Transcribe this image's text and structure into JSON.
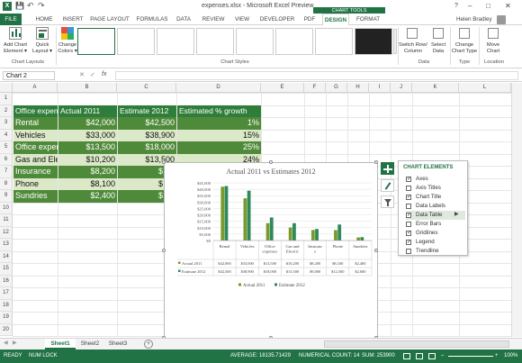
{
  "window": {
    "title": "expenses.xlsx - Microsoft Excel Preview",
    "help_btn": "?",
    "minimize": "–",
    "maximize": "□",
    "close": "✕",
    "user": "Helen Bradley",
    "qat_save": "💾",
    "qat_undo": "↶",
    "qat_redo": "↷"
  },
  "ribbon": {
    "context_label": "CHART TOOLS",
    "tabs": [
      "FILE",
      "HOME",
      "INSERT",
      "PAGE LAYOUT",
      "FORMULAS",
      "DATA",
      "REVIEW",
      "VIEW",
      "DEVELOPER",
      "PDF",
      "DESIGN",
      "FORMAT"
    ],
    "add_chart_element": "Add Chart Element ▾",
    "quick_layout": "Quick Layout ▾",
    "change_colors": "Change Colors ▾",
    "chart_layouts_label": "Chart Layouts",
    "chart_styles_label": "Chart Styles",
    "switch_row_col": "Switch Row/ Column",
    "select_data": "Select Data",
    "data_label": "Data",
    "change_chart_type": "Change Chart Type",
    "type_label": "Type",
    "move_chart": "Move Chart",
    "location_label": "Location"
  },
  "formula_bar": {
    "name_box": "Chart 2",
    "cancel": "✕",
    "enter": "✓",
    "fx": "fx",
    "content": ""
  },
  "grid": {
    "columns": [
      "A",
      "B",
      "C",
      "D",
      "E",
      "F",
      "G",
      "H",
      "I",
      "J",
      "K",
      "L"
    ],
    "rows": [
      "1",
      "2",
      "3",
      "4",
      "5",
      "6",
      "7",
      "8",
      "9",
      "10",
      "11",
      "12",
      "13",
      "14",
      "15",
      "16",
      "17",
      "18",
      "19",
      "20"
    ],
    "header_row": [
      "Office expenses",
      "Actual 2011",
      "Estimate 2012",
      "Estimated % growth"
    ],
    "data_rows": [
      {
        "label": "Rental",
        "actual": "$42,000",
        "estimate": "$42,500",
        "growth": "1%"
      },
      {
        "label": "Vehicles",
        "actual": "$33,000",
        "estimate": "$38,900",
        "growth": "15%"
      },
      {
        "label": "Office expenses",
        "actual": "$13,500",
        "estimate": "$18,000",
        "growth": "25%"
      },
      {
        "label": "Gas and Electric",
        "actual": "$10,200",
        "estimate": "$13,500",
        "growth": "24%"
      },
      {
        "label": "Insurance",
        "actual": "$8,200",
        "estimate": "$",
        "growth": ""
      },
      {
        "label": "Phone",
        "actual": "$8,100",
        "estimate": "$",
        "growth": ""
      },
      {
        "label": "Sundries",
        "actual": "$2,400",
        "estimate": "$",
        "growth": ""
      }
    ]
  },
  "chart_elements": {
    "title": "CHART ELEMENTS",
    "items": [
      {
        "label": "Axes",
        "checked": "✓"
      },
      {
        "label": "Axis Titles",
        "checked": ""
      },
      {
        "label": "Chart Title",
        "checked": "✓"
      },
      {
        "label": "Data Labels",
        "checked": ""
      },
      {
        "label": "Data Table",
        "checked": "✓"
      },
      {
        "label": "Error Bars",
        "checked": ""
      },
      {
        "label": "Gridlines",
        "checked": "✓"
      },
      {
        "label": "Legend",
        "checked": "✓"
      },
      {
        "label": "Trendline",
        "checked": ""
      }
    ],
    "arrow": "▶"
  },
  "chart_data": {
    "type": "bar",
    "title": "Actual 2011 vs Estimates 2012",
    "categories": [
      "Rental",
      "Vehicles",
      "Office expenses",
      "Gas and Electric",
      "Insurance",
      "Phone",
      "Sundries"
    ],
    "category_labels": [
      [
        "Rental"
      ],
      [
        "Vehicles"
      ],
      [
        "Office",
        "expenses"
      ],
      [
        "Gas and",
        "Electric"
      ],
      [
        "Insuranc",
        "e"
      ],
      [
        "Phone"
      ],
      [
        "Sundries"
      ]
    ],
    "series": [
      {
        "name": "Actual 2011",
        "values": [
          42000,
          33000,
          13500,
          10200,
          8200,
          8100,
          2400
        ],
        "color": "#7a9a2e",
        "display": [
          "$42,000",
          "$33,000",
          "$13,500",
          "$10,200",
          "$8,200",
          "$8,100",
          "$2,400"
        ]
      },
      {
        "name": "Estimate 2012",
        "values": [
          42500,
          38900,
          18000,
          13500,
          9000,
          12500,
          2600
        ],
        "color": "#2e8a5a",
        "display": [
          "$42,500",
          "$38,900",
          "$18,000",
          "$13,500",
          "$9,000",
          "$12,500",
          "$2,600"
        ]
      }
    ],
    "yticks": [
      "$45,000",
      "$40,000",
      "$35,000",
      "$30,000",
      "$25,000",
      "$20,000",
      "$15,000",
      "$10,000",
      "$5,000",
      "$0"
    ],
    "ylim": [
      0,
      45000
    ],
    "grid": true,
    "legend": "bottom"
  },
  "sheets": {
    "tabs": [
      "Sheet1",
      "Sheet2",
      "Sheet3"
    ],
    "add": "+",
    "nav_prev": "◀",
    "nav_next": "▶"
  },
  "status": {
    "mode": "READY",
    "numlock": "NUM LOCK",
    "average": "AVERAGE: 18135.71429",
    "count": "NUMERICAL COUNT: 14",
    "sum": "SUM: 253900",
    "zoom": "100%",
    "zoom_minus": "–",
    "zoom_plus": "+"
  },
  "colors": {
    "excel_green": "#217346",
    "table_dark": "#4f8a3a",
    "table_light": "#dbe9c8",
    "header_fill": "#2f7d3a"
  }
}
